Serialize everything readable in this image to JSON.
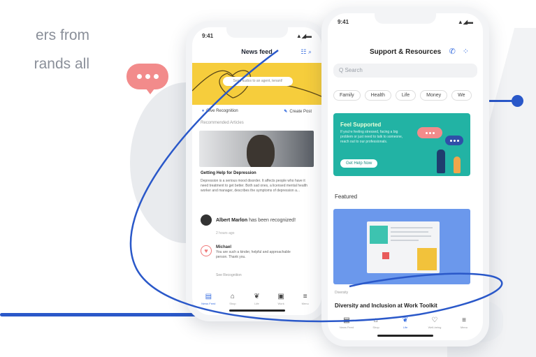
{
  "hero": {
    "line1": "ers from",
    "line2": "rands all"
  },
  "colors": {
    "accent_blue": "#2a58c9",
    "banner_yellow": "#f6cd3c",
    "support_teal": "#22b3a4",
    "bubble_red": "#f28b8b",
    "featured_blue": "#6b98ec"
  },
  "phone_left": {
    "status_time": "9:41",
    "status_icons": "▲◢▬",
    "title": "News feed",
    "banner_search_placeholder": "Send kudos to an agent, tenant!",
    "actions": [
      {
        "icon": "pin-icon",
        "label": "Give Recognition"
      },
      {
        "icon": "pencil-icon",
        "label": "Create Post"
      }
    ],
    "section_label": "Recommended Articles",
    "article_title": "Getting Help for Depression",
    "article_excerpt": "Depression is a serious mood disorder. It affects people who have it need treatment to get better. Both sad ones, a licensed mental health worker and manager, describes the symptoms of depression a...",
    "recognition_name": "Albert Marlon",
    "recognition_text": "has been recognized!",
    "recognition_time": "2 hours ago",
    "comment_author": "Michael",
    "comment_text": "You are such a kinder, helpful and approachable person. Thank you.",
    "recognition_link": "See Recognition",
    "tabs": [
      "News Feed",
      "Shop",
      "Life",
      "Work",
      "Menu"
    ]
  },
  "phone_right": {
    "status_time": "9:41",
    "status_icons": "▲◢▬",
    "title": "Support & Resources",
    "search_placeholder": "Q Search",
    "chips": [
      "Family",
      "Health",
      "Life",
      "Money",
      "We"
    ],
    "support_title": "Feel Supported",
    "support_body": "If you're feeling stressed, facing a big problem or just need to talk to someone, reach out to our professionals.",
    "support_cta": "Get Help Now",
    "featured_label": "Featured",
    "featured_category": "Diversity",
    "featured_title": "Diversity and Inclusion at Work Toolkit",
    "tabs": [
      "News Feed",
      "Shop",
      "Life",
      "Well-being",
      "Menu"
    ]
  }
}
